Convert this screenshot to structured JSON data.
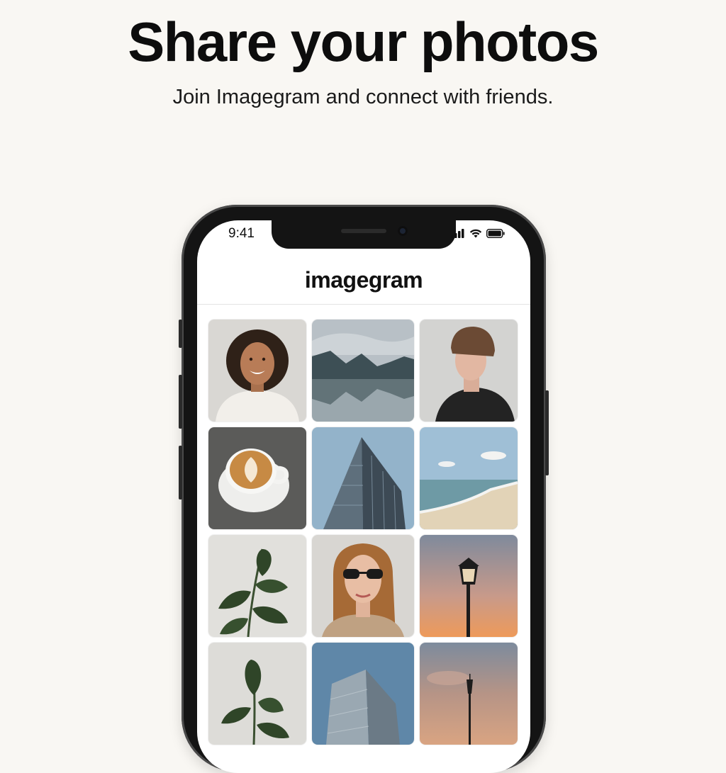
{
  "hero": {
    "title": "Share your photos",
    "subtitle": "Join Imagegram and connect with friends."
  },
  "status_bar": {
    "time": "9:41",
    "icons": [
      "signal-icon",
      "wifi-icon",
      "battery-icon"
    ]
  },
  "app": {
    "title": "imagegram"
  },
  "photos": [
    {
      "subject": "smiling-woman-portrait"
    },
    {
      "subject": "mountain-lake-landscape"
    },
    {
      "subject": "man-in-beanie-profile"
    },
    {
      "subject": "latte-art-coffee-cup"
    },
    {
      "subject": "glass-skyscraper"
    },
    {
      "subject": "beach-shoreline"
    },
    {
      "subject": "plant-leaves"
    },
    {
      "subject": "woman-with-sunglasses"
    },
    {
      "subject": "street-lamp-at-sunset"
    },
    {
      "subject": "potted-plant"
    },
    {
      "subject": "skyscraper-blue-sky"
    },
    {
      "subject": "street-lamp-dusk"
    }
  ],
  "colors": {
    "background": "#f9f7f3",
    "phone_frame": "#141414",
    "text": "#111111"
  }
}
